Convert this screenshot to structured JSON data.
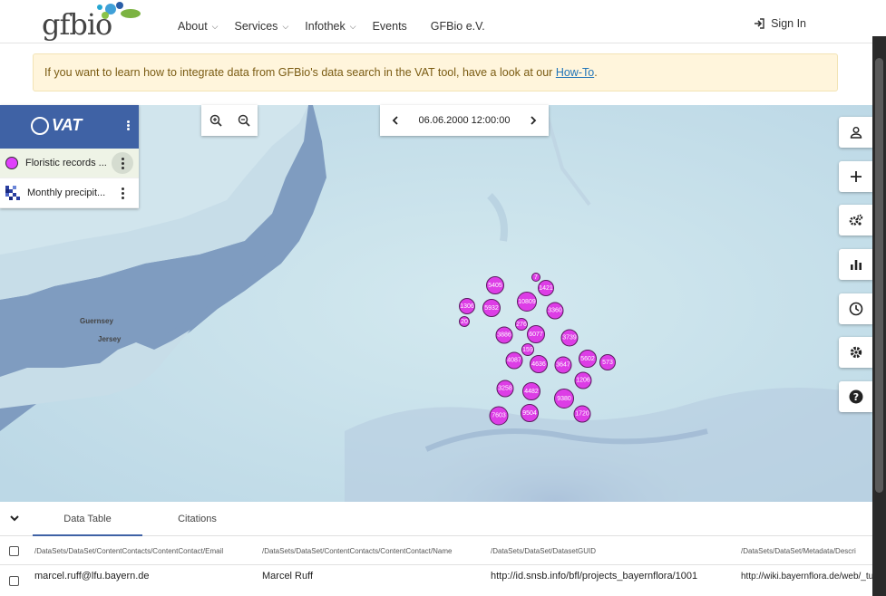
{
  "header": {
    "logo_text": "gfbio",
    "nav": [
      {
        "label": "About",
        "has_dropdown": true
      },
      {
        "label": "Services",
        "has_dropdown": true
      },
      {
        "label": "Infothek",
        "has_dropdown": true
      },
      {
        "label": "Events",
        "has_dropdown": false
      },
      {
        "label": "GFBio e.V.",
        "has_dropdown": false
      }
    ],
    "signin_label": "Sign In"
  },
  "alert": {
    "text_before": "If you want to learn how to integrate data from GFBio's data search in the VAT tool, have a look at our ",
    "link": "How-To",
    "text_after": "."
  },
  "vat": {
    "logo": "VAT",
    "layers": [
      {
        "name": "Floristic records ...",
        "icon": "point-layer-icon",
        "selected": true
      },
      {
        "name": "Monthly precipit...",
        "icon": "raster-layer-icon",
        "selected": false
      }
    ]
  },
  "time": {
    "value": "06.06.2000 12:00:00"
  },
  "map_labels": [
    "Guernsey",
    "Jersey"
  ],
  "toolbar": [
    "account-icon",
    "add-icon",
    "operators-icon",
    "chart-icon",
    "clock-icon",
    "settings-icon",
    "help-icon"
  ],
  "clusters": [
    {
      "label": "7"
    },
    {
      "label": "5405"
    },
    {
      "label": "1421"
    },
    {
      "label": "10809"
    },
    {
      "label": "1306"
    },
    {
      "label": "5932"
    },
    {
      "label": "3360"
    },
    {
      "label": "20"
    },
    {
      "label": "276"
    },
    {
      "label": "3886"
    },
    {
      "label": "6077"
    },
    {
      "label": "3739"
    },
    {
      "label": "159"
    },
    {
      "label": "4087"
    },
    {
      "label": "4636"
    },
    {
      "label": "3647"
    },
    {
      "label": "5602"
    },
    {
      "label": "573"
    },
    {
      "label": "1206"
    },
    {
      "label": "3258"
    },
    {
      "label": "4482"
    },
    {
      "label": "9380"
    },
    {
      "label": "7603"
    },
    {
      "label": "9504"
    },
    {
      "label": "1720"
    }
  ],
  "bottom": {
    "tabs": [
      "Data Table",
      "Citations"
    ],
    "columns": [
      "/DataSets/DataSet/ContentContacts/ContentContact/Email",
      "/DataSets/DataSet/ContentContacts/ContentContact/Name",
      "/DataSets/DataSet/DatasetGUID",
      "/DataSets/DataSet/Metadata/Descri"
    ],
    "rows": [
      [
        "marcel.ruff@lfu.bayern.de",
        "Marcel Ruff",
        "http://id.snsb.info/bfl/projects_bayernflora/1001",
        "http://wiki.bayernflora.de/web/_tudies_of_the_Bayerisches_Lar"
      ]
    ]
  }
}
